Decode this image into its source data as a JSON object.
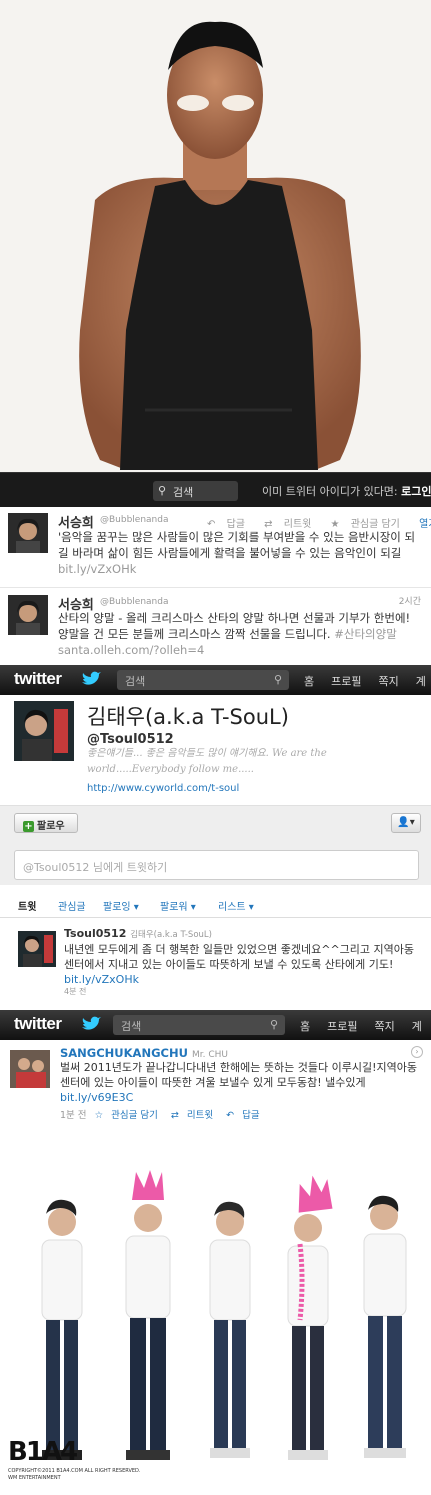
{
  "top_bar": {
    "search_placeholder": "검색",
    "question": "이미 트위터 아이디가 있다면:",
    "login": "로그인"
  },
  "old_tweets": [
    {
      "name": "서승희",
      "handle": "@Bubblenanda",
      "actions": [
        "답글",
        "리트윗",
        "관심글 담기",
        "열기"
      ],
      "text": "'음악을 꿈꾸는 많은 사람들이 많은 기회를 부여받을 수 있는 음반시장이 되길 바라며 삶이 힘든 사람들에게 활력을 불어넣을 수 있는 음악인이 되길",
      "link": "bit.ly/vZxOHk"
    },
    {
      "name": "서승희",
      "handle": "@Bubblenanda",
      "time": "2시간",
      "text": "산타의 양말 - 올레 크리스마스 산타의 양말 하나면 선물과 기부가 한번에! 양말을 건 모든 분들께 크리스마스 깜짝 선물을 드립니다.",
      "hashtag": "#산타의양말",
      "link": "santa.olleh.com/?olleh=4"
    }
  ],
  "twitter_bar": {
    "logo": "twitter",
    "search_placeholder": "검색",
    "nav": [
      "홈",
      "프로필",
      "쪽지",
      "계"
    ]
  },
  "profile": {
    "name": "김태우(a.k.a T-SouL)",
    "handle": "@Tsoul0512",
    "bio": "좋은얘기들... 좋은 음악들도 많이 얘기해요. We are the world.....Everybody follow me.....",
    "url": "http://www.cyworld.com/t-soul",
    "follow_button": "팔로우",
    "tweet_box_placeholder": "@Tsoul0512 님에게 트윗하기",
    "tabs": [
      "트윗",
      "관심글",
      "팔로잉 ▾",
      "팔로워 ▾",
      "리스트 ▾"
    ],
    "tweet": {
      "name": "Tsoul0512",
      "display": "김태우(a.k.a T-SouL)",
      "text": "내년엔 모두에게 좀 더 행복한 일들만 있었으면 좋겠네요^^그리고 지역아동센터에서 지내고 있는 아이들도 따뜻하게 보낼 수 있도록 산타에게 기도!",
      "link": "bit.ly/vZxOHk",
      "time": "4분 전"
    }
  },
  "chu_tweet": {
    "name": "SANGCHUKANGCHU",
    "display": "Mr. CHU",
    "text": "벌써 2011년도가 끝나갑니다내년 한해에는 뜻하는 것들다 이루시길!지역아동센터에 있는 아이들이 따뜻한 겨울 보낼수 있게 모두동참! 낼수있게",
    "link": "bit.ly/v69E3C",
    "time": "1분 전",
    "actions": [
      "관심글 담기",
      "리트윗",
      "답글"
    ]
  },
  "group_photo": {
    "brand": "B1A4",
    "copyright": "COPYRIGHT©2011 B1A4.COM ALL RIGHT RESERVED.",
    "company": "WM ENTERTAINMENT"
  },
  "colors": {
    "link": "#2276bb",
    "dark_bar": "#1a1a1a",
    "twitter_bar": "#222222"
  }
}
